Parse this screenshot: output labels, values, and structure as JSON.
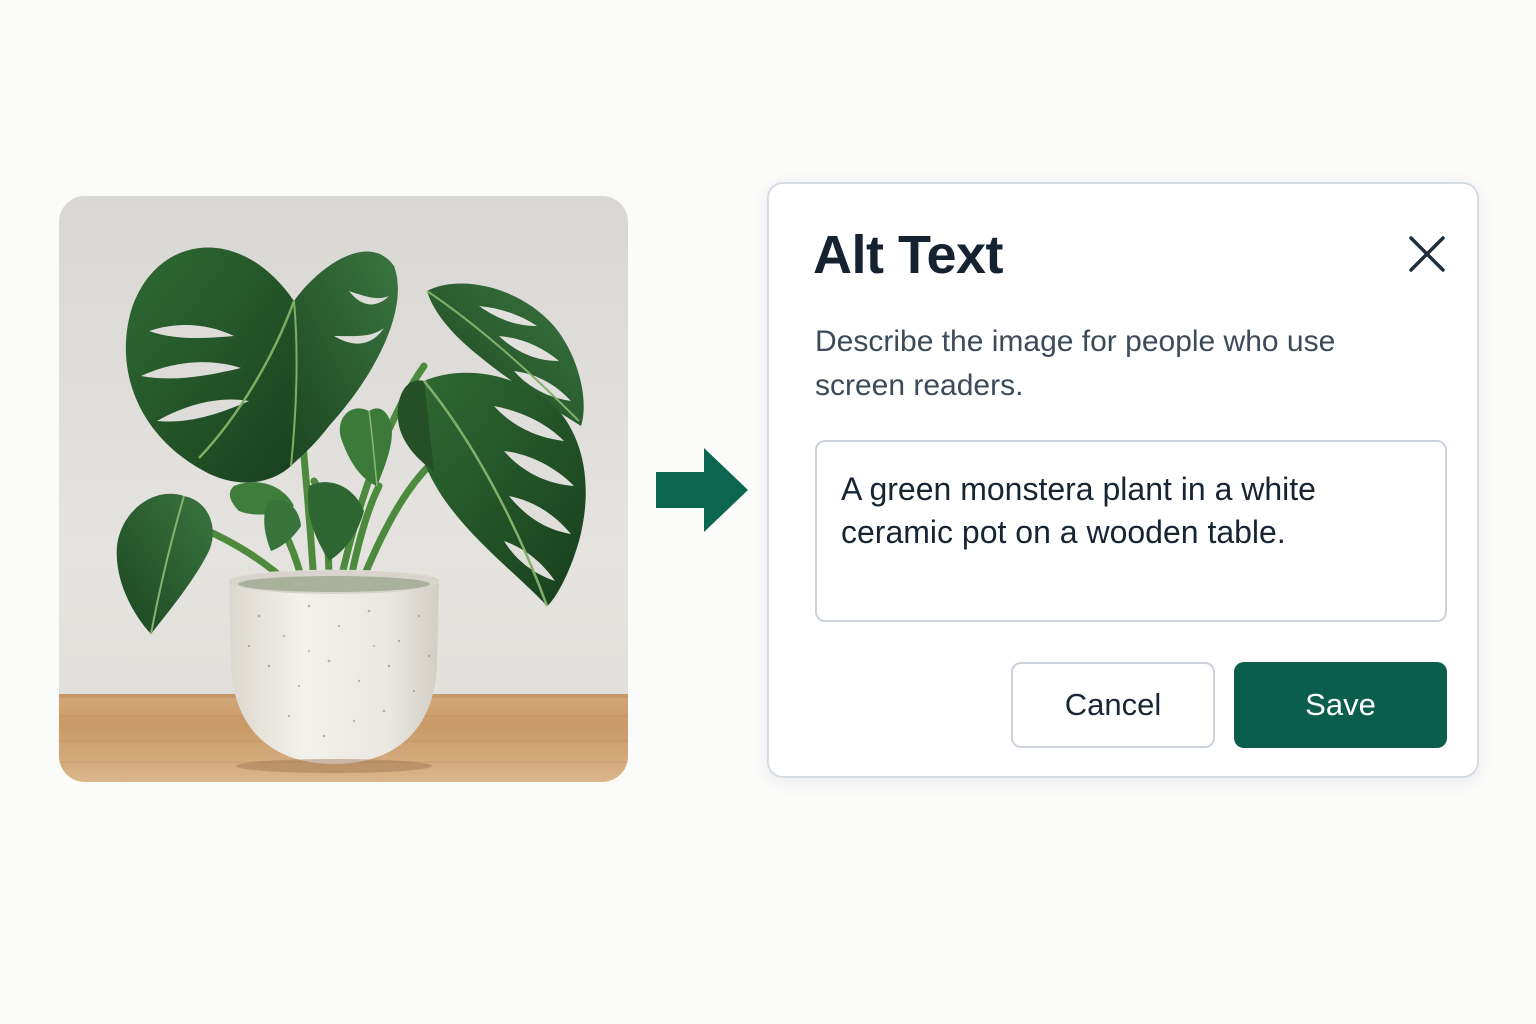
{
  "theme": {
    "accent": "#0b5e4c",
    "arrow": "#0b6650",
    "title_color": "#142232",
    "text_color": "#3c4a5a"
  },
  "photo": {
    "subject": "monstera plant in white speckled ceramic pot on wooden table"
  },
  "arrow": {
    "icon": "arrow-right-icon"
  },
  "dialog": {
    "title": "Alt Text",
    "close_icon": "close-icon",
    "description": "Describe the image for people who use screen readers.",
    "alt_text_value": "A green monstera plant in a white ceramic pot on a wooden table.",
    "cancel_label": "Cancel",
    "save_label": "Save"
  }
}
